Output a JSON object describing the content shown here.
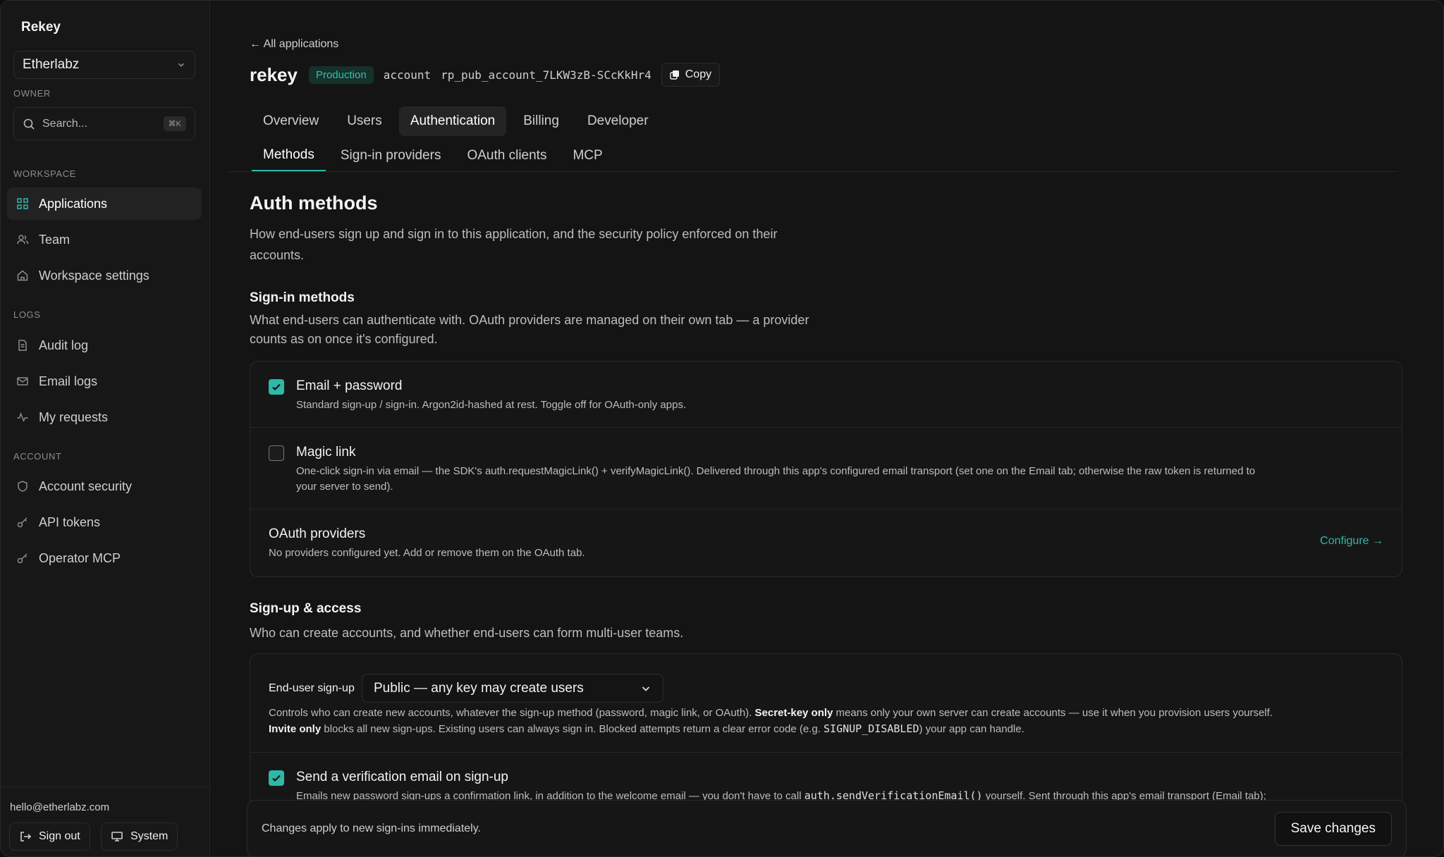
{
  "sidebar": {
    "brand": "Rekey",
    "org": "Etherlabz",
    "owner_label": "OWNER",
    "search_placeholder": "Search...",
    "search_shortcut": "⌘K",
    "workspace_label": "WORKSPACE",
    "logs_label": "LOGS",
    "account_label": "ACCOUNT",
    "items": [
      {
        "label": "Applications",
        "icon": "grid-icon"
      },
      {
        "label": "Team",
        "icon": "users-icon"
      },
      {
        "label": "Workspace settings",
        "icon": "home-icon"
      },
      {
        "label": "Audit log",
        "icon": "file-icon"
      },
      {
        "label": "Email logs",
        "icon": "mail-icon"
      },
      {
        "label": "My requests",
        "icon": "activity-icon"
      },
      {
        "label": "Account security",
        "icon": "shield-icon"
      },
      {
        "label": "API tokens",
        "icon": "key-icon"
      },
      {
        "label": "Operator MCP",
        "icon": "key-icon"
      }
    ],
    "user_email": "hello@etherlabz.com",
    "sign_out": "Sign out",
    "theme": "System"
  },
  "header": {
    "back": "← All applications",
    "app_name": "rekey",
    "env": "Production",
    "key_label": "account",
    "key_value": "rp_pub_account_7LKW3zB-SCcKkHr4",
    "copy": "Copy"
  },
  "tabs": [
    "Overview",
    "Users",
    "Authentication",
    "Billing",
    "Developer"
  ],
  "active_tab": "Authentication",
  "subtabs": [
    "Methods",
    "Sign-in providers",
    "OAuth clients",
    "MCP"
  ],
  "active_subtab": "Methods",
  "content": {
    "title": "Auth methods",
    "intro_line1": "How end-users sign up and sign in to this application, and the security policy enforced on their",
    "intro_line2": "accounts.",
    "signin_title": "Sign-in methods",
    "signin_desc_line1": "What end-users can authenticate with. OAuth providers are managed on their own tab — a provider",
    "signin_desc_line2": "counts as on once it's configured.",
    "methods": {
      "email": {
        "title": "Email + password",
        "checked": true,
        "desc": "Standard sign-up / sign-in. Argon2id-hashed at rest. Toggle off for OAuth-only apps."
      },
      "magic": {
        "title": "Magic link",
        "checked": false,
        "desc_line1": "One-click sign-in via email — the SDK's auth.requestMagicLink() + verifyMagicLink(). Delivered through this app's configured email transport (set one on the Email tab; otherwise the raw token is returned to",
        "desc_line2": "your server to send)."
      },
      "oauth": {
        "title": "OAuth providers",
        "desc": "No providers configured yet. Add or remove them on the OAuth tab.",
        "action": "Configure →"
      }
    },
    "signup_title": "Sign-up & access",
    "signup_desc": "Who can create accounts, and whether end-users can form multi-user teams.",
    "signup": {
      "label": "End-user sign-up",
      "value": "Public — any key may create users",
      "desc_a": "Controls who can create new accounts, whatever the sign-up method (password, magic link, or OAuth). ",
      "desc_b": "Secret-key only",
      "desc_c": " means only your own server can create accounts — use it when you provision users yourself.",
      "desc_d": "Invite only",
      "desc_e": " blocks all new sign-ups. Existing users can always sign in. Blocked attempts return a clear error code (e.g. ",
      "desc_code": "SIGNUP_DISABLED",
      "desc_f": ") your app can handle."
    },
    "verify": {
      "title": "Send a verification email on sign-up",
      "checked": true,
      "desc_a": "Emails new password sign-ups a confirmation link, in addition to the welcome email — you don't have to call ",
      "desc_code": "auth.sendVerificationEmail()",
      "desc_b": " yourself. Sent through this app's email transport (Email tab);"
    }
  },
  "savebar": {
    "text": "Changes apply to new sign-ins immediately.",
    "button": "Save changes"
  },
  "colors": {
    "accent": "#2fb8a8",
    "background": "#141414"
  }
}
